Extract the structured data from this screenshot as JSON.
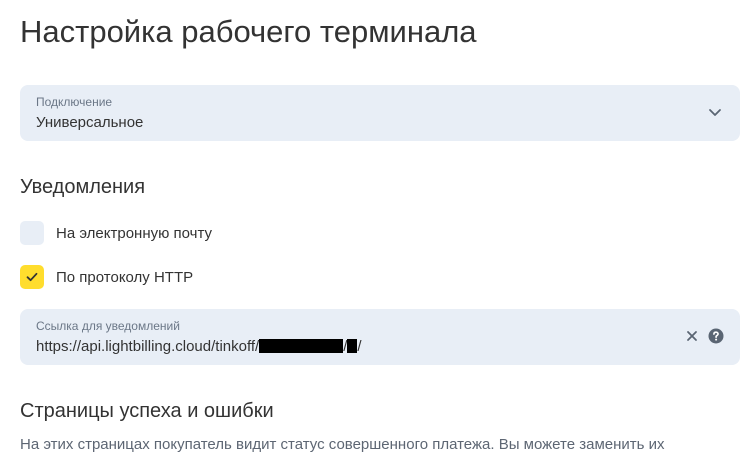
{
  "page": {
    "title": "Настройка рабочего терминала"
  },
  "connection": {
    "label": "Подключение",
    "value": "Универсальное",
    "icon": "chevron-down-icon"
  },
  "notifications": {
    "heading": "Уведомления",
    "email": {
      "label": "На электронную почту",
      "checked": false
    },
    "http": {
      "label": "По протоколу HTTP",
      "checked": true
    },
    "url_field": {
      "label": "Ссылка для уведомлений",
      "value_prefix": "https://api.lightbilling.cloud/tinkoff/",
      "separator": "/",
      "value_suffix": "/"
    }
  },
  "pages_section": {
    "heading": "Страницы успеха и ошибки",
    "description": "На этих страницах покупатель видит статус совершенного платежа. Вы можете заменить их"
  },
  "colors": {
    "field_bg": "#e8eef6",
    "accent_yellow": "#ffdd2d",
    "text": "#333333",
    "muted_text": "#6b7787"
  }
}
